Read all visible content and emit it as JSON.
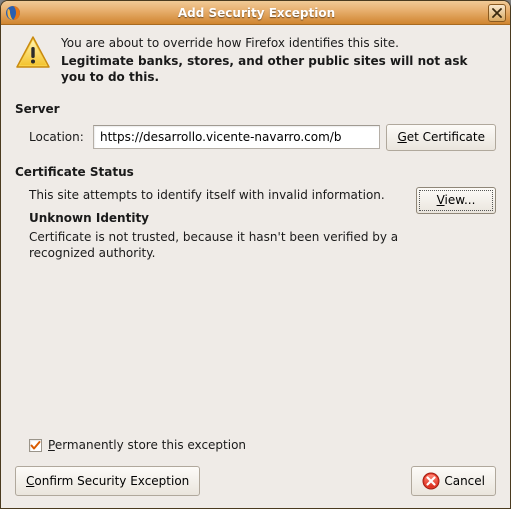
{
  "window": {
    "title": "Add Security Exception"
  },
  "intro": {
    "line1": "You are about to override how Firefox identifies this site.",
    "line2": "Legitimate banks, stores, and other public sites will not ask you to do this."
  },
  "server": {
    "header": "Server",
    "location_label": "Location:",
    "location_value": "https://desarrollo.vicente-navarro.com/b",
    "get_cert_prefix": "G",
    "get_cert_rest": "et Certificate"
  },
  "cert_status": {
    "header": "Certificate Status",
    "attempt_text": "This site attempts to identify itself with invalid information.",
    "view_prefix": "V",
    "view_rest": "iew...",
    "unknown_header": "Unknown Identity",
    "unknown_text": "Certificate is not trusted, because it hasn't been verified by a recognized authority."
  },
  "permanent": {
    "prefix": "P",
    "rest": "ermanently store this exception",
    "checked": true
  },
  "footer": {
    "confirm_prefix": "C",
    "confirm_rest": "onfirm Security Exception",
    "cancel": "Cancel"
  }
}
